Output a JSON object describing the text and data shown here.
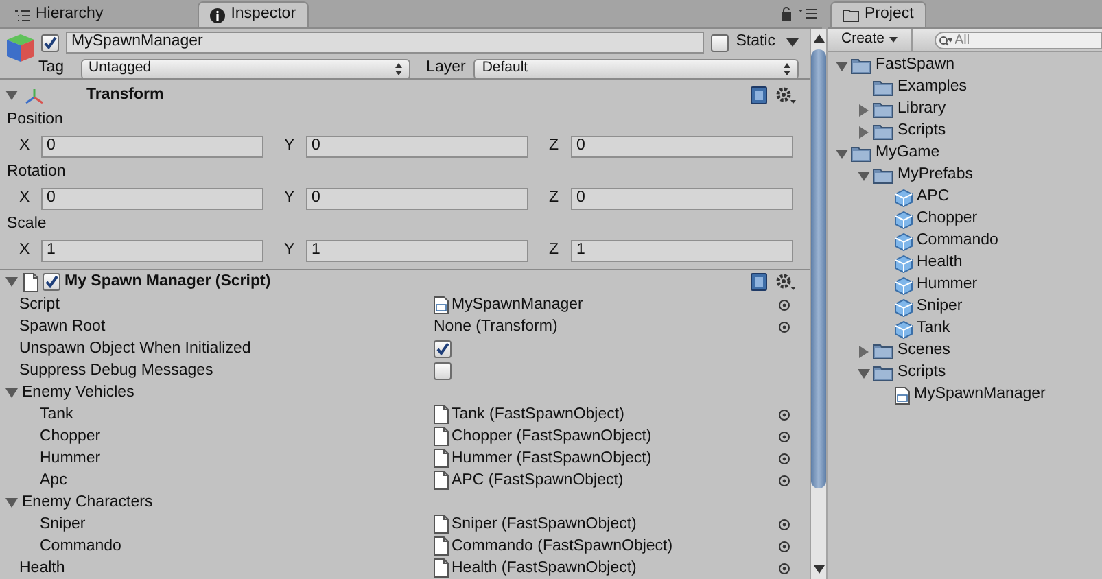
{
  "inspector_tabs": [
    {
      "label": "Hierarchy",
      "selected": false
    },
    {
      "label": "Inspector",
      "selected": true
    }
  ],
  "object": {
    "active": true,
    "name": "MySpawnManager",
    "static_label": "Static",
    "static": false,
    "tag_label": "Tag",
    "tag_value": "Untagged",
    "layer_label": "Layer",
    "layer_value": "Default"
  },
  "transform": {
    "title": "Transform",
    "expanded": true,
    "groups": [
      {
        "label": "Position",
        "fields": [
          {
            "axis": "X",
            "value": "0"
          },
          {
            "axis": "Y",
            "value": "0"
          },
          {
            "axis": "Z",
            "value": "0"
          }
        ]
      },
      {
        "label": "Rotation",
        "fields": [
          {
            "axis": "X",
            "value": "0"
          },
          {
            "axis": "Y",
            "value": "0"
          },
          {
            "axis": "Z",
            "value": "0"
          }
        ]
      },
      {
        "label": "Scale",
        "fields": [
          {
            "axis": "X",
            "value": "1"
          },
          {
            "axis": "Y",
            "value": "1"
          },
          {
            "axis": "Z",
            "value": "1"
          }
        ]
      }
    ]
  },
  "script_component": {
    "title": "My Spawn Manager (Script)",
    "enabled": true,
    "expanded": true,
    "properties": [
      {
        "kind": "script",
        "label": "Script",
        "value": "MySpawnManager"
      },
      {
        "kind": "reference",
        "label": "Spawn Root",
        "value": "None (Transform)"
      },
      {
        "kind": "checkbox",
        "label": "Unspawn Object When Initialized",
        "checked": true
      },
      {
        "kind": "checkbox",
        "label": "Suppress Debug Messages",
        "checked": false
      },
      {
        "kind": "foldout",
        "label": "Enemy Vehicles",
        "expanded": true,
        "children": [
          {
            "kind": "asset",
            "label": "Tank",
            "value": "Tank (FastSpawnObject)"
          },
          {
            "kind": "asset",
            "label": "Chopper",
            "value": "Chopper (FastSpawnObject)"
          },
          {
            "kind": "asset",
            "label": "Hummer",
            "value": "Hummer (FastSpawnObject)"
          },
          {
            "kind": "asset",
            "label": "Apc",
            "value": "APC (FastSpawnObject)"
          }
        ]
      },
      {
        "kind": "foldout",
        "label": "Enemy Characters",
        "expanded": true,
        "children": [
          {
            "kind": "asset",
            "label": "Sniper",
            "value": "Sniper (FastSpawnObject)"
          },
          {
            "kind": "asset",
            "label": "Commando",
            "value": "Commando (FastSpawnObject)"
          }
        ]
      },
      {
        "kind": "asset",
        "label": "Health",
        "value": "Health (FastSpawnObject)"
      }
    ]
  },
  "project": {
    "tab": {
      "label": "Project",
      "selected": true
    },
    "create_label": "Create",
    "search_placeholder": "All",
    "tree": [
      {
        "kind": "folder",
        "label": "FastSpawn",
        "expanded": true,
        "children": [
          {
            "kind": "empty_folder",
            "label": "Examples"
          },
          {
            "kind": "folder",
            "label": "Library",
            "expanded": false
          },
          {
            "kind": "folder",
            "label": "Scripts",
            "expanded": false
          }
        ]
      },
      {
        "kind": "folder",
        "label": "MyGame",
        "expanded": true,
        "children": [
          {
            "kind": "folder",
            "label": "MyPrefabs",
            "expanded": true,
            "children": [
              {
                "kind": "prefab",
                "label": "APC"
              },
              {
                "kind": "prefab",
                "label": "Chopper"
              },
              {
                "kind": "prefab",
                "label": "Commando"
              },
              {
                "kind": "prefab",
                "label": "Health"
              },
              {
                "kind": "prefab",
                "label": "Hummer"
              },
              {
                "kind": "prefab",
                "label": "Sniper"
              },
              {
                "kind": "prefab",
                "label": "Tank"
              }
            ]
          },
          {
            "kind": "folder",
            "label": "Scenes",
            "expanded": false
          },
          {
            "kind": "folder",
            "label": "Scripts",
            "expanded": true,
            "children": [
              {
                "kind": "script",
                "label": "MySpawnManager"
              }
            ]
          }
        ]
      }
    ]
  }
}
